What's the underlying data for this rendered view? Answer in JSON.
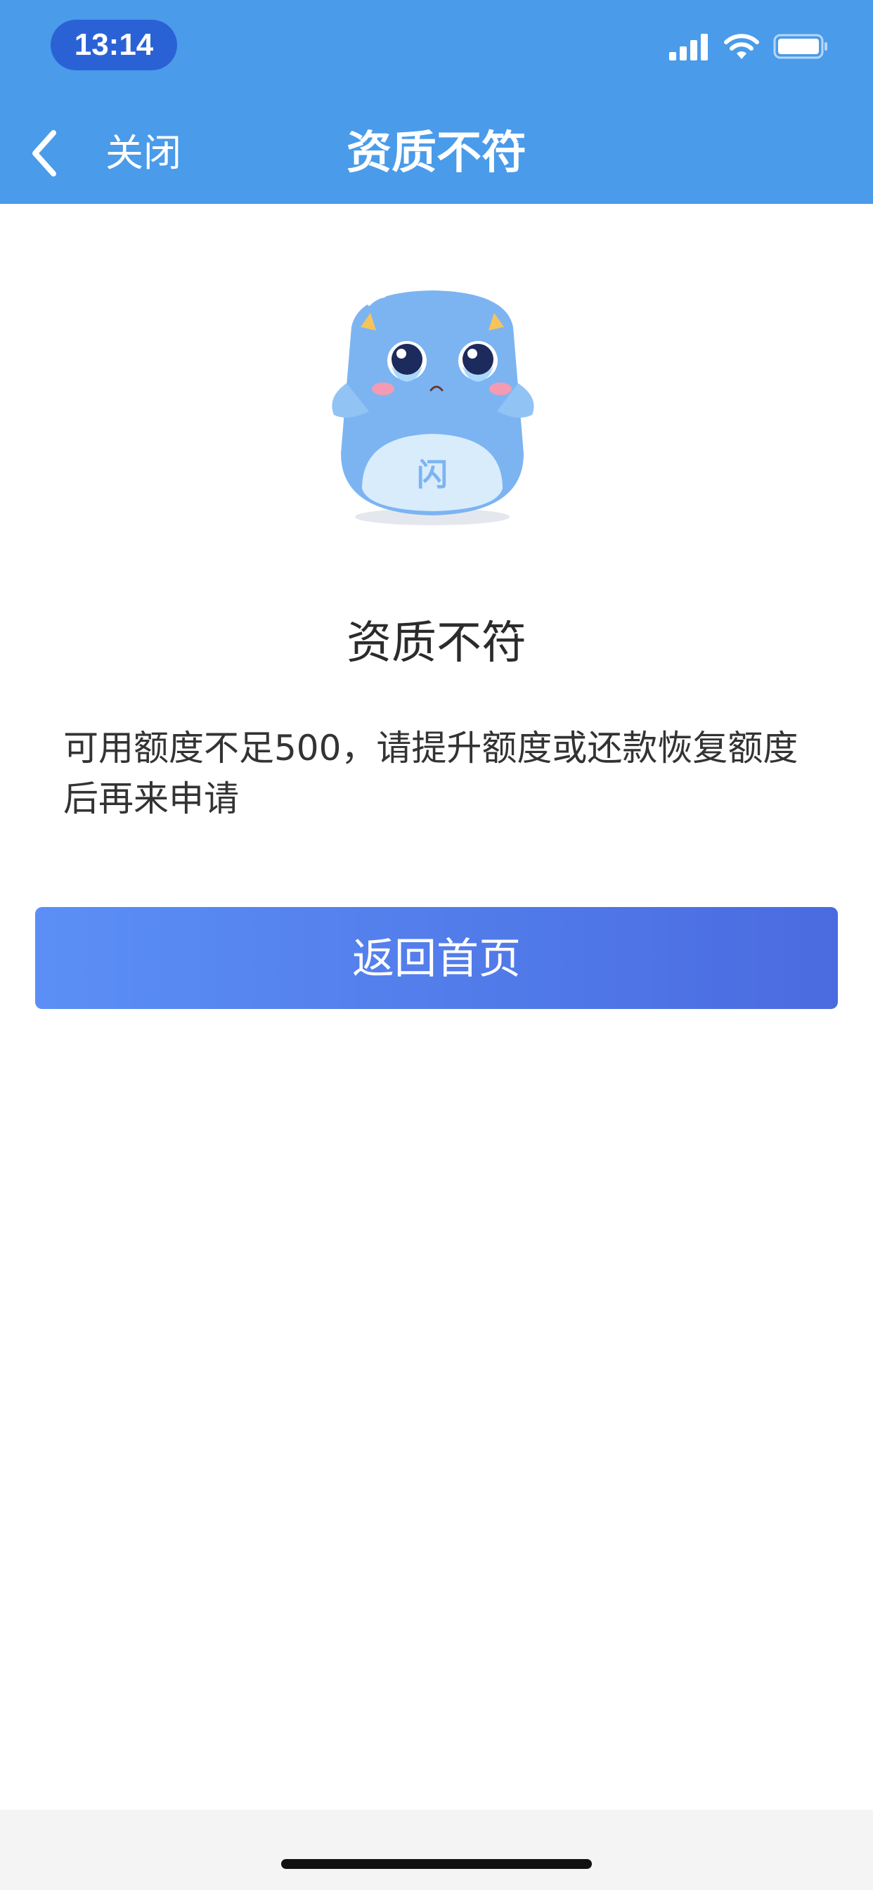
{
  "status_bar": {
    "time": "13:14"
  },
  "nav": {
    "close_label": "关闭",
    "title": "资质不符"
  },
  "mascot": {
    "badge_text": "闪"
  },
  "result": {
    "title": "资质不符",
    "description": "可用额度不足500，请提升额度或还款恢复额度后再来申请"
  },
  "actions": {
    "home_button_label": "返回首页"
  },
  "colors": {
    "header": "#4a9bea",
    "time_pill": "#2a62d6",
    "button_start": "#5b8ff6",
    "button_end": "#4a6be0"
  }
}
